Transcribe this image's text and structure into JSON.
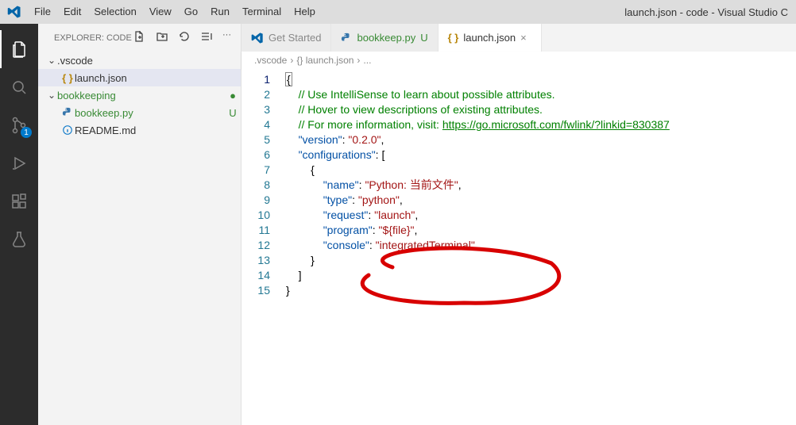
{
  "title": "launch.json - code - Visual Studio C",
  "menu": [
    "File",
    "Edit",
    "Selection",
    "View",
    "Go",
    "Run",
    "Terminal",
    "Help"
  ],
  "explorer": {
    "header": "EXPLORER: CODE",
    "folders": [
      {
        "name": ".vscode",
        "expanded": true,
        "children": [
          {
            "name": "launch.json",
            "icon": "braces",
            "active": true
          }
        ]
      },
      {
        "name": "bookkeeping",
        "expanded": true,
        "status": "●",
        "green": true,
        "children": [
          {
            "name": "bookkeep.py",
            "icon": "py",
            "status": "U",
            "green": true
          },
          {
            "name": "README.md",
            "icon": "info"
          }
        ]
      }
    ]
  },
  "scm_badge": "1",
  "tabs": [
    {
      "label": "Get Started",
      "icon": "vs",
      "active": false,
      "suffix": ""
    },
    {
      "label": "bookkeep.py",
      "icon": "py",
      "active": false,
      "suffix": "U",
      "green": true
    },
    {
      "label": "launch.json",
      "icon": "braces",
      "active": true,
      "close": "×"
    }
  ],
  "breadcrumb": [
    ".vscode",
    "{} launch.json",
    "..."
  ],
  "code": {
    "lines": [
      {
        "n": 1,
        "cur": true,
        "html": "<span class='cursor-box c-punc'>{</span>"
      },
      {
        "n": 2,
        "html": "    <span class='c-com'>// Use IntelliSense to learn about possible attributes.</span>"
      },
      {
        "n": 3,
        "html": "    <span class='c-com'>// Hover to view descriptions of existing attributes.</span>"
      },
      {
        "n": 4,
        "html": "    <span class='c-com'>// For more information, visit: </span><span class='c-url'>https://go.microsoft.com/fwlink/?linkid=830387</span>"
      },
      {
        "n": 5,
        "html": "    <span class='c-key'>\"version\"</span><span class='c-punc'>: </span><span class='c-str'>\"0.2.0\"</span><span class='c-punc'>,</span>"
      },
      {
        "n": 6,
        "html": "    <span class='c-key'>\"configurations\"</span><span class='c-punc'>: [</span>"
      },
      {
        "n": 7,
        "html": "        <span class='c-punc'>{</span>"
      },
      {
        "n": 8,
        "html": "            <span class='c-key'>\"name\"</span><span class='c-punc'>: </span><span class='c-str'>\"Python: 当前文件\"</span><span class='c-punc'>,</span>"
      },
      {
        "n": 9,
        "html": "            <span class='c-key'>\"type\"</span><span class='c-punc'>: </span><span class='c-str'>\"python\"</span><span class='c-punc'>,</span>"
      },
      {
        "n": 10,
        "html": "            <span class='c-key'>\"request\"</span><span class='c-punc'>: </span><span class='c-str'>\"launch\"</span><span class='c-punc'>,</span>"
      },
      {
        "n": 11,
        "html": "            <span class='c-key'>\"program\"</span><span class='c-punc'>: </span><span class='c-str'>\"${file}\"</span><span class='c-punc'>,</span>"
      },
      {
        "n": 12,
        "html": "            <span class='c-key'>\"console\"</span><span class='c-punc'>: </span><span class='c-str'>\"integratedTerminal\"</span>"
      },
      {
        "n": 13,
        "html": "        <span class='c-punc'>}</span>"
      },
      {
        "n": 14,
        "html": "    <span class='c-punc'>]</span>"
      },
      {
        "n": 15,
        "html": "<span class='c-punc'>}</span>"
      }
    ]
  }
}
